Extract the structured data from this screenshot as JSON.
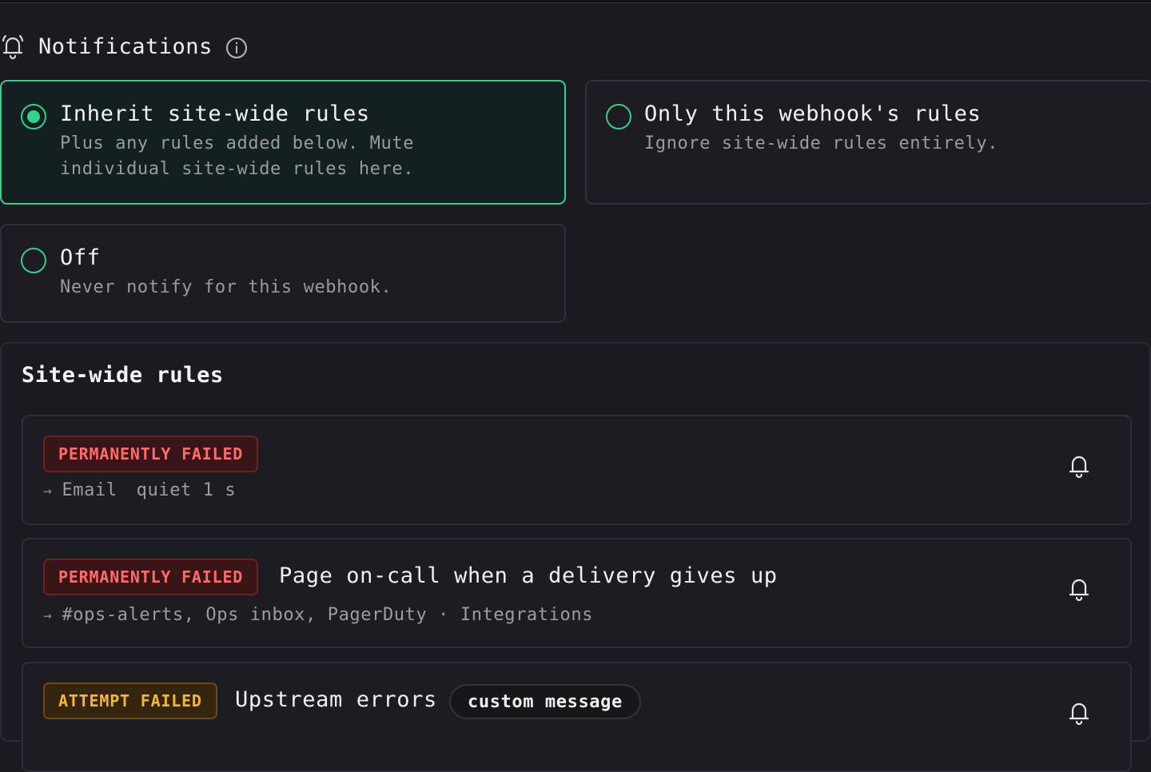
{
  "header": {
    "title": "Notifications"
  },
  "modes": {
    "inherit": {
      "title": "Inherit site-wide rules",
      "desc_line1": "Plus any rules added below. Mute",
      "desc_line2": "individual site-wide rules here.",
      "selected": true
    },
    "only": {
      "title": "Only this webhook's rules",
      "desc": "Ignore site-wide rules entirely.",
      "selected": false
    },
    "off": {
      "title": "Off",
      "desc": "Never notify for this webhook.",
      "selected": false
    }
  },
  "sitewide": {
    "title": "Site-wide rules",
    "rules": [
      {
        "badge": "PERMANENTLY FAILED",
        "badge_kind": "perm",
        "title": "",
        "arrow": "→",
        "targets": "Email",
        "extra": "quiet 1 s"
      },
      {
        "badge": "PERMANENTLY FAILED",
        "badge_kind": "perm",
        "title": "Page on-call when a delivery gives up",
        "arrow": "→",
        "targets": "#ops-alerts, Ops inbox, PagerDuty · Integrations"
      },
      {
        "badge": "ATTEMPT FAILED",
        "badge_kind": "attempt",
        "title": "Upstream errors",
        "pill": "custom message"
      }
    ]
  },
  "colors": {
    "accent": "#2fd38a",
    "perm": "#ff6b6b",
    "attempt": "#f7b731"
  },
  "icons": {
    "header": "bell-icon",
    "info": "info-icon",
    "rule": "bell-icon"
  }
}
